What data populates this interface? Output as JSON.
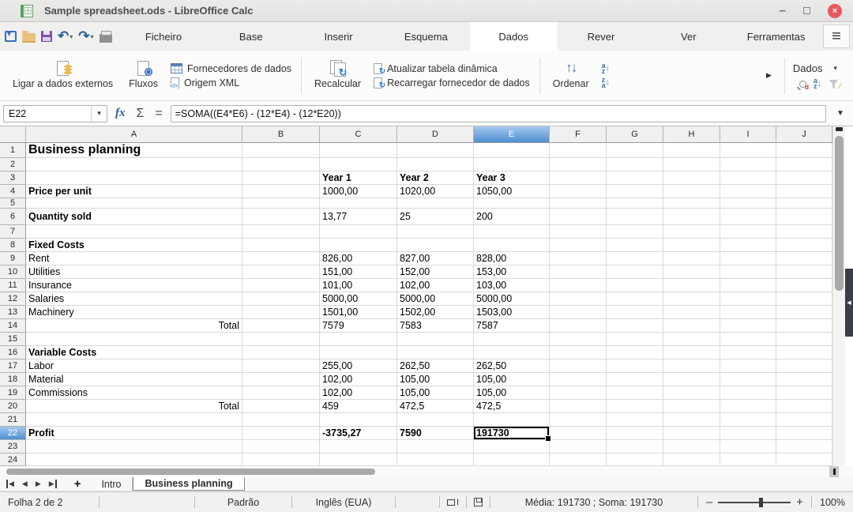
{
  "window": {
    "title": "Sample spreadsheet.ods - LibreOffice Calc"
  },
  "menu": {
    "tabs": [
      "Ficheiro",
      "Base",
      "Inserir",
      "Esquema",
      "Dados",
      "Rever",
      "Ver",
      "Ferramentas"
    ],
    "active_tab": "Dados"
  },
  "toolbar": {
    "link_external_label": "Ligar a dados externos",
    "streams_label": "Fluxos",
    "data_provider_label": "Fornecedores de dados",
    "xml_source_label": "Origem XML",
    "recalculate_label": "Recalcular",
    "refresh_pivot_label": "Atualizar tabela dinâmica",
    "reload_provider_label": "Recarregar fornecedor de dados",
    "sort_label": "Ordenar",
    "context_dropdown_label": "Dados"
  },
  "formula_bar": {
    "cell_reference": "E22",
    "formula": "=SOMA((E4*E6) - (12*E4) - (12*E20))"
  },
  "grid": {
    "columns": [
      "A",
      "B",
      "C",
      "D",
      "E",
      "F",
      "G",
      "H",
      "I",
      "J"
    ],
    "selected_column": "E",
    "selected_row": 22,
    "rows": [
      {
        "n": 1,
        "cells": [
          {
            "col": "A",
            "text": "Business planning",
            "cls": "title"
          }
        ]
      },
      {
        "n": 2,
        "cells": []
      },
      {
        "n": 3,
        "cells": [
          {
            "col": "C",
            "text": "Year 1",
            "cls": "b"
          },
          {
            "col": "D",
            "text": "Year 2",
            "cls": "b"
          },
          {
            "col": "E",
            "text": "Year 3",
            "cls": "b"
          }
        ]
      },
      {
        "n": 4,
        "cells": [
          {
            "col": "A",
            "text": "Price per unit",
            "cls": "b"
          },
          {
            "col": "C",
            "text": "1000,00"
          },
          {
            "col": "D",
            "text": "1020,00"
          },
          {
            "col": "E",
            "text": "1050,00"
          }
        ]
      },
      {
        "n": 5,
        "cells": []
      },
      {
        "n": 6,
        "cells": [
          {
            "col": "A",
            "text": "Quantity sold",
            "cls": "b"
          },
          {
            "col": "C",
            "text": "13,77"
          },
          {
            "col": "D",
            "text": "25"
          },
          {
            "col": "E",
            "text": "200"
          }
        ]
      },
      {
        "n": 7,
        "cells": []
      },
      {
        "n": 8,
        "cells": [
          {
            "col": "A",
            "text": "Fixed Costs",
            "cls": "b"
          }
        ]
      },
      {
        "n": 9,
        "cells": [
          {
            "col": "A",
            "text": "Rent"
          },
          {
            "col": "C",
            "text": "826,00"
          },
          {
            "col": "D",
            "text": "827,00"
          },
          {
            "col": "E",
            "text": "828,00"
          }
        ]
      },
      {
        "n": 10,
        "cells": [
          {
            "col": "A",
            "text": "Utilities"
          },
          {
            "col": "C",
            "text": "151,00"
          },
          {
            "col": "D",
            "text": "152,00"
          },
          {
            "col": "E",
            "text": "153,00"
          }
        ]
      },
      {
        "n": 11,
        "cells": [
          {
            "col": "A",
            "text": "Insurance"
          },
          {
            "col": "C",
            "text": "101,00"
          },
          {
            "col": "D",
            "text": "102,00"
          },
          {
            "col": "E",
            "text": "103,00"
          }
        ]
      },
      {
        "n": 12,
        "cells": [
          {
            "col": "A",
            "text": "Salaries"
          },
          {
            "col": "C",
            "text": "5000,00"
          },
          {
            "col": "D",
            "text": "5000,00"
          },
          {
            "col": "E",
            "text": "5000,00"
          }
        ]
      },
      {
        "n": 13,
        "cells": [
          {
            "col": "A",
            "text": "Machinery"
          },
          {
            "col": "C",
            "text": "1501,00"
          },
          {
            "col": "D",
            "text": "1502,00"
          },
          {
            "col": "E",
            "text": "1503,00"
          }
        ]
      },
      {
        "n": 14,
        "cells": [
          {
            "col": "A",
            "text": "Total",
            "cls": "right"
          },
          {
            "col": "C",
            "text": "7579"
          },
          {
            "col": "D",
            "text": "7583"
          },
          {
            "col": "E",
            "text": "7587"
          }
        ]
      },
      {
        "n": 15,
        "cells": []
      },
      {
        "n": 16,
        "cells": [
          {
            "col": "A",
            "text": "Variable Costs",
            "cls": "b"
          }
        ]
      },
      {
        "n": 17,
        "cells": [
          {
            "col": "A",
            "text": "Labor"
          },
          {
            "col": "C",
            "text": "255,00"
          },
          {
            "col": "D",
            "text": "262,50"
          },
          {
            "col": "E",
            "text": "262,50"
          }
        ]
      },
      {
        "n": 18,
        "cells": [
          {
            "col": "A",
            "text": "Material"
          },
          {
            "col": "C",
            "text": "102,00"
          },
          {
            "col": "D",
            "text": "105,00"
          },
          {
            "col": "E",
            "text": "105,00"
          }
        ]
      },
      {
        "n": 19,
        "cells": [
          {
            "col": "A",
            "text": "Commissions"
          },
          {
            "col": "C",
            "text": "102,00"
          },
          {
            "col": "D",
            "text": "105,00"
          },
          {
            "col": "E",
            "text": "105,00"
          }
        ]
      },
      {
        "n": 20,
        "cells": [
          {
            "col": "A",
            "text": "Total",
            "cls": "right"
          },
          {
            "col": "C",
            "text": "459"
          },
          {
            "col": "D",
            "text": "472,5"
          },
          {
            "col": "E",
            "text": "472,5"
          }
        ]
      },
      {
        "n": 21,
        "cells": []
      },
      {
        "n": 22,
        "cells": [
          {
            "col": "A",
            "text": "Profit",
            "cls": "b"
          },
          {
            "col": "C",
            "text": "-3735,27",
            "cls": "b"
          },
          {
            "col": "D",
            "text": "7590",
            "cls": "b"
          },
          {
            "col": "E",
            "text": "191730",
            "cls": "b sel"
          }
        ]
      },
      {
        "n": 23,
        "cells": []
      },
      {
        "n": 24,
        "cells": []
      }
    ]
  },
  "sheets": {
    "tabs": [
      "Intro",
      "Business planning"
    ],
    "active_tab": "Business planning"
  },
  "status_bar": {
    "sheet_position": "Folha 2 de 2",
    "page_style": "Padrão",
    "language": "Inglês (EUA)",
    "selection_stats": "Média: 191730 ; Soma: 191730",
    "zoom_level": "100%"
  },
  "icons": {
    "undo": "↶",
    "redo": "↷",
    "dropdown": "▾",
    "overflow": "▶",
    "refresh": "↻",
    "sort_updown": "↑↓",
    "sort_az_a": "a",
    "sort_az_z": "z",
    "arrow_down": "↓",
    "minimize": "–",
    "close": "×",
    "hamburger": "≡",
    "fx": "fx",
    "sigma": "Σ",
    "equals": "=",
    "expand_formula": "▼",
    "nav_prev": "◀",
    "nav_next": "▶",
    "add_sheet": "+",
    "sidebar_expand": "◀",
    "insert_mode_letter": "I",
    "zoom_minus": "–",
    "zoom_plus": "+"
  },
  "colors": {
    "accent_blue": "#4e8fd3",
    "header_highlight_top": "#a5c8ee",
    "close_red": "#e9595c",
    "selection_border": "#000000"
  }
}
